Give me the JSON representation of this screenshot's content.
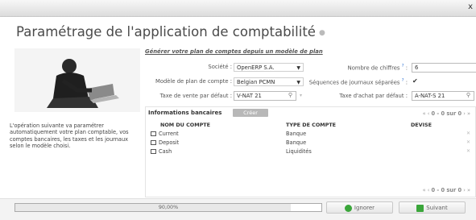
{
  "window": {
    "close_label": "x"
  },
  "page": {
    "title": "Paramétrage de l'application de comptabilité"
  },
  "intro": {
    "text": "L'opération suivante va paramétrer automatiquement votre plan comptable, vos comptes bancaires, les taxes et les journaux selon le modèle choisi."
  },
  "form": {
    "section_title": "Générer votre plan de comptes depuis un modèle de plan",
    "company": {
      "label": "Société :",
      "value": "OpenERP S.A."
    },
    "digits": {
      "label": "Nombre de chiffres",
      "qmark": "?",
      "colon": ":",
      "value": "6"
    },
    "chart_template": {
      "label": "Modèle de plan de compte :",
      "value": "Belgian PCMN"
    },
    "separate_sequences": {
      "label": "Séquences de journaux séparées",
      "qmark": "?",
      "colon": ":",
      "checked_glyph": "✔"
    },
    "sale_tax": {
      "label": "Taxe de vente par défaut :",
      "value": "V-NAT 21"
    },
    "purchase_tax": {
      "label": "Taxe d'achat par défaut :",
      "value": "A-NAT-S 21"
    }
  },
  "bank": {
    "title": "Informations bancaires",
    "create_label": "Créer",
    "pager_top": "0 - 0 sur 0",
    "pager_bottom": "0 - 0 sur 0",
    "columns": [
      "NOM DU COMPTE",
      "TYPE DE COMPTE",
      "DEVISE"
    ],
    "rows": [
      {
        "name": "Current",
        "type": "Banque",
        "currency": ""
      },
      {
        "name": "Deposit",
        "type": "Banque",
        "currency": ""
      },
      {
        "name": "Cash",
        "type": "Liquidités",
        "currency": ""
      }
    ]
  },
  "footer": {
    "progress_label": "90,00%",
    "progress_value": 0.9,
    "skip_label": "Ignorer",
    "next_label": "Suivant"
  },
  "colors": {
    "accent_green": "#3aa63a",
    "link_blue": "#3b7bd6"
  }
}
